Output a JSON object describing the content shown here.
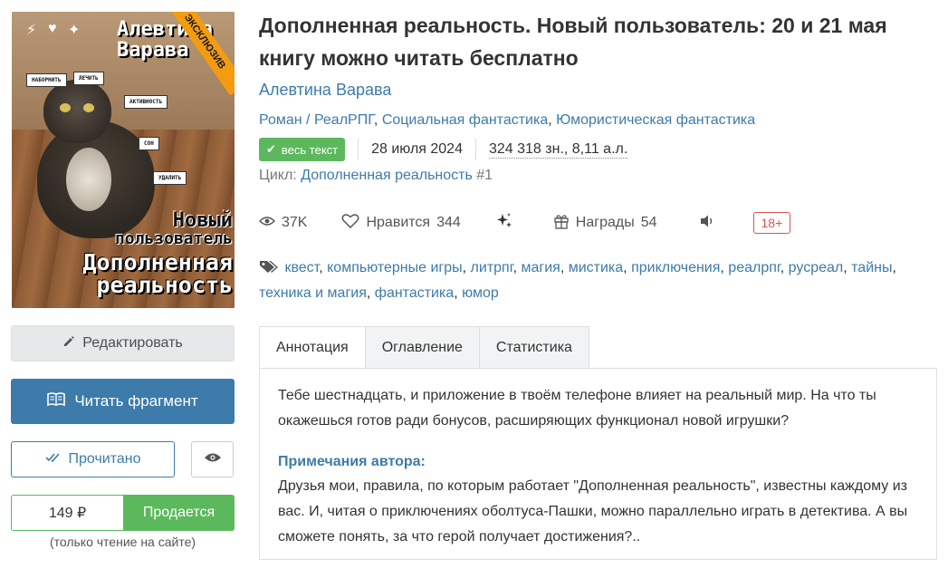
{
  "book": {
    "title": "Дополненная реальность. Новый пользователь: 20 и 21 мая книгу можно читать бесплатно",
    "author": "Алевтина Варава",
    "genres": [
      "Роман / РеалРПГ",
      "Социальная фантастика",
      "Юмористическая фантастика"
    ],
    "badge": "весь текст",
    "date": "28 июля 2024",
    "size": "324 318 зн., 8,11 а.л.",
    "cycle_label": "Цикл:",
    "cycle_name": "Дополненная реальность",
    "cycle_num": "#1"
  },
  "cover": {
    "author_line1": "Алевтина",
    "author_line2": "Варава",
    "ribbon": "ЭКСКЛЮЗИВ",
    "title_line1": "Новый",
    "title_line2": "пользователь",
    "title_line3": "Дополненная",
    "title_line4": "реальность",
    "chips": [
      "НАБОРНИТЬ",
      "ЛЕЧИТЬ",
      "АКТИВНОСТЬ",
      "СОН",
      "УДАЛИТЬ"
    ]
  },
  "stats": {
    "views": "37K",
    "likes_label": "Нравится",
    "likes": "344",
    "awards_label": "Награды",
    "awards": "54",
    "age": "18+"
  },
  "tags": [
    "квест",
    "компьютерные игры",
    "литрпг",
    "магия",
    "мистика",
    "приключения",
    "реалрпг",
    "русреал",
    "тайны",
    "техника и магия",
    "фантастика",
    "юмор"
  ],
  "tabs": [
    "Аннотация",
    "Оглавление",
    "Статистика"
  ],
  "annotation": {
    "text": "Тебе шестнадцать, и приложение в твоём телефоне влияет на реальный мир. На что ты окажешься готов ради бонусов, расширяющих функционал новой игрушки?",
    "notes_heading": "Примечания автора:",
    "notes_text": "Друзья мои, правила, по которым работает \"Дополненная реальность\", известны каждому из вас. И, читая о приключениях оболтуса-Пашки, можно параллельно играть в детектива. А вы сможете понять, за что герой получает достижения?.."
  },
  "actions": {
    "edit": "Редактировать",
    "read": "Читать фрагмент",
    "done": "Прочитано",
    "price": "149 ₽",
    "sell": "Продается",
    "note": "(только чтение на сайте)"
  },
  "colors": {
    "link": "#3d7bab",
    "green": "#5cb85c",
    "age": "#d9534f"
  }
}
